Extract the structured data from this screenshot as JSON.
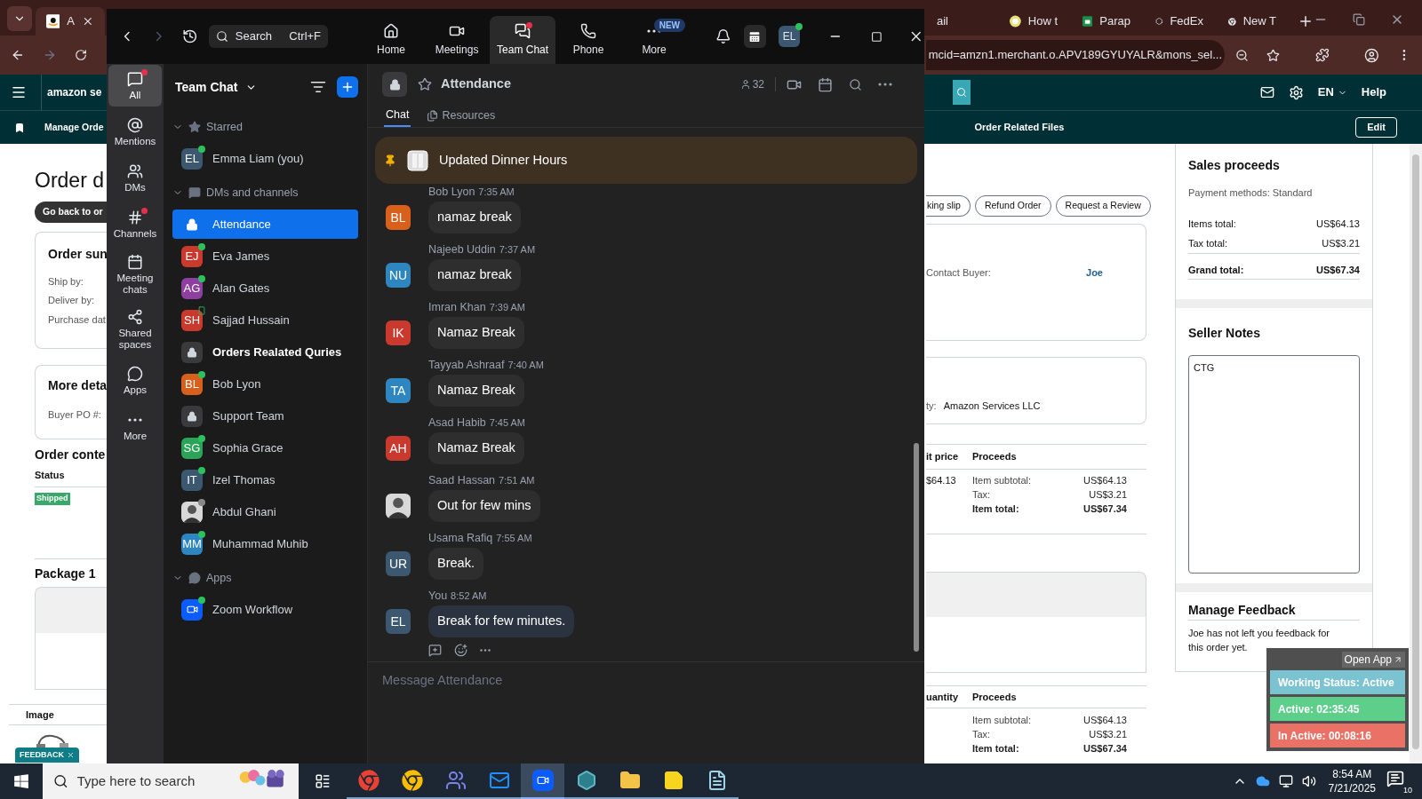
{
  "browser": {
    "tabs": [
      {
        "label": "A",
        "kind": "amazon",
        "selected": true
      },
      {
        "label": "ail",
        "kind": "none",
        "selected": false
      },
      {
        "label": "How t",
        "kind": "circle",
        "selected": false
      },
      {
        "label": "Parap",
        "kind": "sheet",
        "selected": false
      },
      {
        "label": "FedEx",
        "kind": "knot",
        "selected": false
      },
      {
        "label": "New T",
        "kind": "chrome",
        "selected": false
      }
    ],
    "address": "mcid=amzn1.merchant.o.APV189GYUYALR&mons_sel..."
  },
  "seller": {
    "logo": "amazon se",
    "language": "EN",
    "help": "Help",
    "nav_left": "Manage Orde",
    "nav_right": "Order Related Files",
    "edit": "Edit",
    "title": "Order d",
    "back_button": "Go back to or",
    "summary": {
      "title": "Order sun",
      "labels": [
        "Ship by:",
        "Deliver by:",
        "Purchase dat"
      ]
    },
    "more_details": {
      "title": "More deta",
      "labels": [
        "Buyer PO #:"
      ]
    },
    "contents": {
      "title": "Order conte",
      "status_header": "Status",
      "status": "Shipped"
    },
    "package": "Package 1",
    "image_header": "Image",
    "feedback_tab": "FEEDBACK",
    "actions": [
      "king slip",
      "Refund Order",
      "Request a Review"
    ],
    "contact": {
      "label": "Contact Buyer:",
      "value": "Joe"
    },
    "party": {
      "label": "ty:",
      "value": "Amazon Services LLC"
    },
    "table1": {
      "columns": [
        "it price",
        "Proceeds"
      ],
      "unit_price": "$64.13",
      "rows": [
        {
          "label": "Item subtotal:",
          "value": "US$64.13",
          "bold": false
        },
        {
          "label": "Tax:",
          "value": "US$3.21",
          "bold": false
        },
        {
          "label": "Item total:",
          "value": "US$67.34",
          "bold": true
        }
      ]
    },
    "table2": {
      "columns": [
        "uantity",
        "Proceeds"
      ],
      "rows": [
        {
          "label": "Item subtotal:",
          "value": "US$64.13",
          "bold": false
        },
        {
          "label": "Tax:",
          "value": "US$3.21",
          "bold": false
        },
        {
          "label": "Item total:",
          "value": "US$67.34",
          "bold": true
        }
      ]
    },
    "sales": {
      "title": "Sales proceeds",
      "payment": "Payment methods: Standard",
      "rows": [
        {
          "label": "Items total:",
          "value": "US$64.13",
          "bold": false
        },
        {
          "label": "Tax total:",
          "value": "US$3.21",
          "bold": false
        },
        {
          "label": "Grand total:",
          "value": "US$67.34",
          "bold": true
        }
      ]
    },
    "notes": {
      "title": "Seller Notes",
      "value": "CTG"
    },
    "feedback": {
      "title": "Manage Feedback",
      "text": "Joe has not left you feedback for this order yet."
    }
  },
  "zoom": {
    "search": {
      "placeholder": "Search",
      "shortcut": "Ctrl+F"
    },
    "nav": [
      {
        "label": "Home",
        "kind": "home",
        "selected": false,
        "dot": false
      },
      {
        "label": "Meetings",
        "kind": "meetings",
        "selected": false,
        "dot": false
      },
      {
        "label": "Team Chat",
        "kind": "chat",
        "selected": true,
        "dot": true
      },
      {
        "label": "Phone",
        "kind": "phone",
        "selected": false,
        "dot": false
      },
      {
        "label": "More",
        "kind": "more",
        "selected": false,
        "dot": false,
        "badge": "NEW"
      }
    ],
    "avatar": "EL",
    "rail": [
      {
        "label": "All",
        "kind": "all",
        "selected": true,
        "dot": true
      },
      {
        "label": "Mentions",
        "kind": "mentions",
        "selected": false,
        "dot": false
      },
      {
        "label": "DMs",
        "kind": "dms",
        "selected": false,
        "dot": false
      },
      {
        "label": "Channels",
        "kind": "channels",
        "selected": false,
        "dot": true
      },
      {
        "label": "Meeting chats",
        "kind": "meeting",
        "selected": false,
        "dot": false
      },
      {
        "label": "Shared spaces",
        "kind": "shared",
        "selected": false,
        "dot": false
      },
      {
        "label": "Apps",
        "kind": "apps",
        "selected": false,
        "dot": false
      },
      {
        "label": "More",
        "kind": "more",
        "selected": false,
        "dot": false
      }
    ],
    "sidebar": {
      "title": "Team Chat",
      "sections": [
        {
          "label": "Starred",
          "kind": "starred",
          "expanded": true,
          "items": [
            {
              "name": "Emma Liam (you)",
              "kind": "initials",
              "initials": "EL",
              "color": "#3b5870",
              "online": true,
              "mobile": false,
              "selected": false,
              "unread": false
            }
          ]
        },
        {
          "label": "DMs and channels",
          "kind": "dms",
          "expanded": true,
          "items": [
            {
              "name": "Attendance",
              "kind": "channel",
              "selected": true,
              "unread": false
            },
            {
              "name": "Eva James",
              "kind": "initials",
              "initials": "EJ",
              "color": "#c9392d",
              "online": true,
              "mobile": false,
              "selected": false,
              "unread": false
            },
            {
              "name": "Alan Gates",
              "kind": "initials",
              "initials": "AG",
              "color": "#8e3fa0",
              "online": true,
              "mobile": false,
              "selected": false,
              "unread": false
            },
            {
              "name": "Sajjad Hussain",
              "kind": "initials",
              "initials": "SH",
              "color": "#c9392d",
              "online": true,
              "mobile": true,
              "selected": false,
              "unread": false
            },
            {
              "name": "Orders Realated Quries",
              "kind": "channel",
              "selected": false,
              "unread": true
            },
            {
              "name": "Bob Lyon",
              "kind": "initials",
              "initials": "BL",
              "color": "#d9601c",
              "online": true,
              "mobile": false,
              "selected": false,
              "unread": false
            },
            {
              "name": "Support Team",
              "kind": "channel",
              "selected": false,
              "unread": false
            },
            {
              "name": "Sophia Grace",
              "kind": "initials",
              "initials": "SG",
              "color": "#2ba45a",
              "online": true,
              "mobile": false,
              "selected": false,
              "unread": false
            },
            {
              "name": "Izel Thomas",
              "kind": "initials",
              "initials": "IT",
              "color": "#3b5870",
              "online": true,
              "mobile": false,
              "selected": false,
              "unread": false
            },
            {
              "name": "Abdul Ghani",
              "online": false,
              "mobile": false,
              "selected": false,
              "unread": false
            },
            {
              "name": "Muhammad Muhib",
              "kind": "initials",
              "initials": "MM",
              "color": "#2e86c1",
              "online": true,
              "mobile": false,
              "selected": false,
              "unread": false
            }
          ]
        },
        {
          "label": "Apps",
          "kind": "apps",
          "expanded": true,
          "items": [
            {
              "name": "Zoom Workflow",
              "kind": "app",
              "online": true,
              "mobile": false,
              "selected": false,
              "unread": false
            }
          ]
        }
      ]
    },
    "channel": {
      "name": "Attendance",
      "members": "32",
      "tabs": [
        {
          "label": "Chat",
          "selected": true
        },
        {
          "label": "Resources",
          "selected": false
        }
      ],
      "pinned": "Updated Dinner Hours",
      "messages": [
        {
          "author": "Bob Lyon",
          "time": "7:35 AM",
          "kind": "initials",
          "initials": "BL",
          "color": "#d9601c",
          "text": "namaz break",
          "own": false
        },
        {
          "author": "Najeeb Uddin",
          "time": "7:37 AM",
          "kind": "initials",
          "initials": "NU",
          "color": "#2e86c1",
          "text": "namaz break",
          "own": false
        },
        {
          "author": "Imran Khan",
          "time": "7:39 AM",
          "kind": "initials",
          "initials": "IK",
          "color": "#c9392d",
          "text": "Namaz Break",
          "own": false
        },
        {
          "author": "Tayyab Ashraaf",
          "time": "7:40 AM",
          "kind": "initials",
          "initials": "TA",
          "color": "#2e86c1",
          "text": "Namaz Break",
          "own": false
        },
        {
          "author": "Asad Habib",
          "time": "7:45 AM",
          "kind": "initials",
          "initials": "AH",
          "color": "#c9392d",
          "text": "Namaz Break",
          "own": false
        },
        {
          "author": "Saad Hassan",
          "time": "7:51 AM",
          "text": "Out for few mins",
          "own": false
        },
        {
          "author": "Usama Rafiq",
          "time": "7:55 AM",
          "kind": "initials",
          "initials": "UR",
          "color": "#3b5870",
          "text": "Break.",
          "own": false
        },
        {
          "author": "You",
          "time": "8:52 AM",
          "kind": "initials",
          "initials": "EL",
          "color": "#3b5870",
          "text": "Break for few minutes.",
          "own": true
        }
      ],
      "composer": {
        "placeholder": "Message Attendance"
      }
    }
  },
  "tracker": {
    "open_app": "Open App",
    "statuses": [
      {
        "label": "Working Status: Active",
        "color": "#7cc3d1"
      },
      {
        "label": "Active: 02:35:45",
        "color": "#5ecf8a"
      },
      {
        "label": "In Active: 00:08:16",
        "color": "#ea7166"
      }
    ]
  },
  "taskbar": {
    "search": {
      "placeholder": "Type here to search"
    },
    "apps": [
      {
        "kind": "chrome",
        "selected": false
      },
      {
        "kind": "chrome_profile",
        "selected": false
      },
      {
        "kind": "teams",
        "selected": false
      },
      {
        "kind": "outlook",
        "selected": false
      },
      {
        "kind": "zoom",
        "selected": true
      },
      {
        "kind": "diamond",
        "selected": false
      },
      {
        "kind": "folder",
        "selected": false
      },
      {
        "kind": "notes",
        "selected": false
      },
      {
        "kind": "paper",
        "selected": false
      }
    ],
    "time": "8:54 AM",
    "date": "7/21/2025",
    "notifications": "10"
  }
}
